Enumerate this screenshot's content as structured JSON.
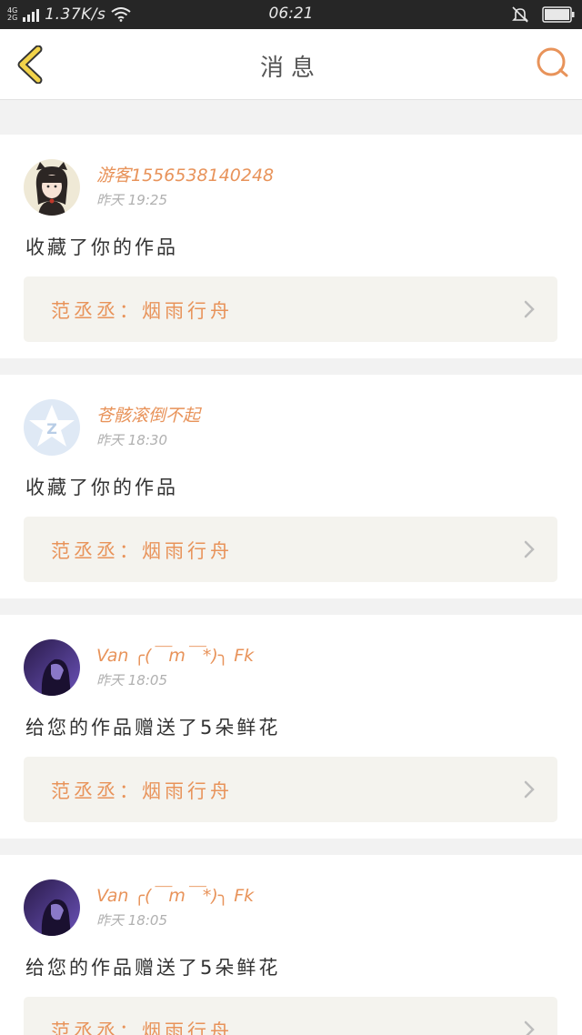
{
  "status_bar": {
    "network_top": "4G",
    "network_bottom": "2G",
    "speed": "1.37K/s",
    "time": "06:21"
  },
  "header": {
    "title": "消息",
    "icons": {
      "back": "back-chevron-icon",
      "search": "search-icon"
    },
    "accent_color": "#e8935a"
  },
  "messages": [
    {
      "username": "游客15565381402​48",
      "time": "昨天 19:25",
      "action": "收藏了你的作品",
      "work_label": "范丞丞：烟雨行舟"
    },
    {
      "username": "苍骸滚倒不起",
      "time": "昨天 18:30",
      "action": "收藏了你的作品",
      "work_label": "范丞丞：烟雨行舟"
    },
    {
      "username": "Van ╭(￣m￣*)╮ Fk",
      "time": "昨天 18:05",
      "action": "给您的作品赠送了5朵鲜花",
      "work_label": "范丞丞：烟雨行舟"
    },
    {
      "username": "Van ╭(￣m￣*)╮ Fk",
      "time": "昨天 18:05",
      "action": "给您的作品赠送了5朵鲜花",
      "work_label": "范丞丞：烟雨行舟"
    }
  ]
}
